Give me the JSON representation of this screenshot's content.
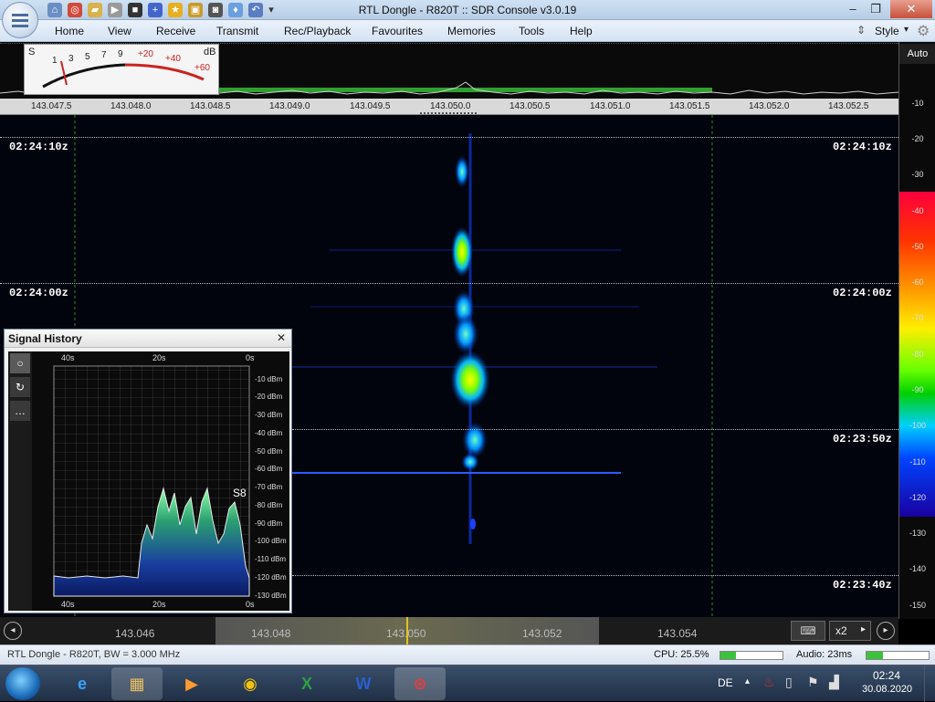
{
  "window": {
    "title": "RTL Dongle - R820T :: SDR Console v3.0.19"
  },
  "menu": [
    "Home",
    "View",
    "Receive",
    "Transmit",
    "Rec/Playback",
    "Favourites",
    "Memories",
    "Tools",
    "Help"
  ],
  "style_label": "Style",
  "auto_label": "Auto",
  "smeter": {
    "s_label": "S",
    "db_label": "dB",
    "marks": [
      "1",
      "3",
      "5",
      "7",
      "9",
      "+20",
      "+40",
      "+60"
    ]
  },
  "freq_ticks": [
    "143.047.5",
    "143.048.0",
    "143.048.5",
    "143.049.0",
    "143.049.5",
    "143.050.0",
    "143.050.5",
    "143.051.0",
    "143.051.5",
    "143.052.0",
    "143.052.5"
  ],
  "db_ticks": [
    "-10",
    "-20",
    "-30",
    "-40",
    "-50",
    "-60",
    "-70",
    "-80",
    "-90",
    "-100",
    "-110",
    "-120",
    "-130",
    "-140",
    "-150"
  ],
  "timestamps": [
    "02:24:10z",
    "02:24:00z",
    "02:23:50z",
    "02:23:40z"
  ],
  "signal_history": {
    "title": "Signal History",
    "close": "✕",
    "time_top": [
      "40s",
      "20s",
      "0s"
    ],
    "time_bottom": [
      "40s",
      "20s",
      "0s"
    ],
    "dbm_ticks": [
      "-10 dBm",
      "-20 dBm",
      "-30 dBm",
      "-40 dBm",
      "-50 dBm",
      "-60 dBm",
      "-70 dBm",
      "-80 dBm",
      "-90 dBm",
      "-100 dBm",
      "-110 dBm",
      "-120 dBm",
      "-130 dBm"
    ],
    "smeter_reading": "S8",
    "tools": [
      "○",
      "↻",
      "…"
    ]
  },
  "bottom_scale": {
    "ticks": [
      "143.046",
      "143.048",
      "143.050",
      "143.052",
      "143.054"
    ],
    "zoom": "x2"
  },
  "status": {
    "device": "RTL Dongle - R820T, BW = 3.000 MHz",
    "cpu": "CPU: 25.5%",
    "cpu_level": 0.255,
    "audio": "Audio: 23ms"
  },
  "taskbar": {
    "lang": "DE",
    "time": "02:24",
    "date": "30.08.2020"
  },
  "colors": {
    "accent": "#2a7de1",
    "waterfall_bg": "#02040d",
    "titlebar": "#c6d9ef"
  }
}
